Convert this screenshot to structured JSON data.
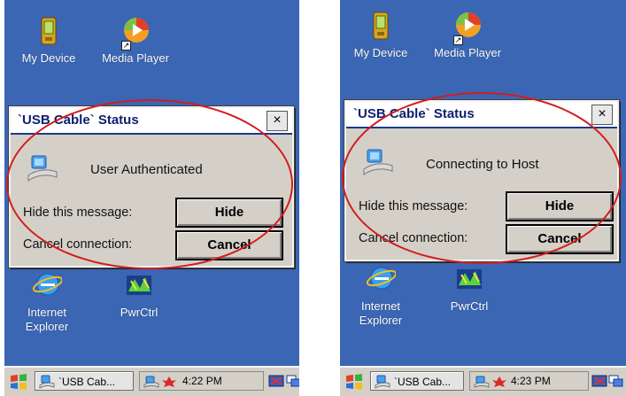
{
  "screens": [
    {
      "desktop": {
        "my_device": "My Device",
        "media_player": "Media Player",
        "internet_explorer": "Internet\nExplorer",
        "pwrctrl": "PwrCtrl"
      },
      "dialog": {
        "title": "`USB Cable` Status",
        "close": "×",
        "status": "User Authenticated",
        "hide_label": "Hide this message:",
        "hide_button": "Hide",
        "cancel_label": "Cancel connection:",
        "cancel_button": "Cancel"
      },
      "taskbar": {
        "task_label": "`USB Cab...",
        "clock": "4:22 PM"
      }
    },
    {
      "desktop": {
        "my_device": "My Device",
        "media_player": "Media Player",
        "internet_explorer": "Internet\nExplorer",
        "pwrctrl": "PwrCtrl"
      },
      "dialog": {
        "title": "`USB Cable` Status",
        "close": "×",
        "status": "Connecting to Host",
        "hide_label": "Hide this message:",
        "hide_button": "Hide",
        "cancel_label": "Cancel connection:",
        "cancel_button": "Cancel"
      },
      "taskbar": {
        "task_label": "`USB Cab...",
        "clock": "4:23 PM"
      }
    }
  ],
  "colors": {
    "desktop": "#3a66b4",
    "annotation_ring": "#d41c1c",
    "dialog_face": "#d4d0c8"
  }
}
